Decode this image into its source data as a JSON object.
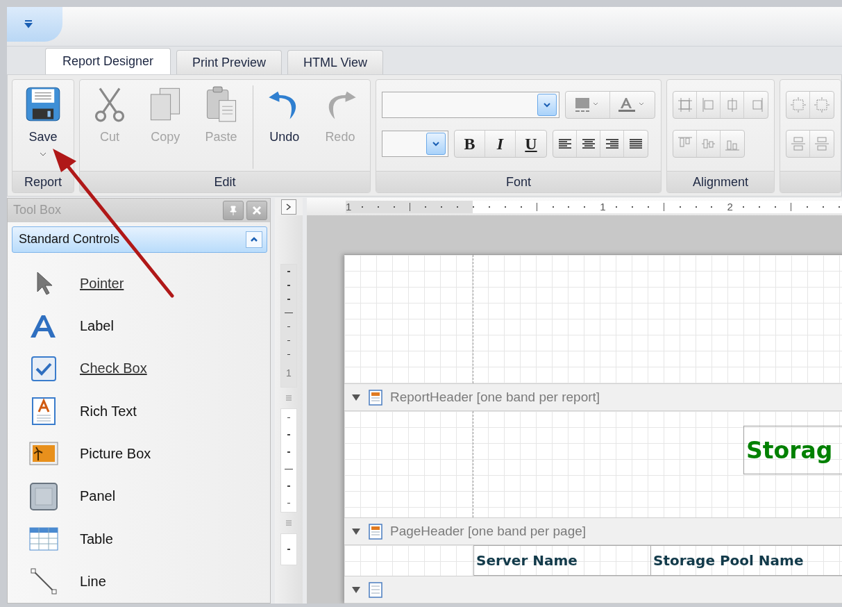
{
  "tabs": [
    {
      "label": "Report Designer",
      "selected": true
    },
    {
      "label": "Print Preview",
      "selected": false
    },
    {
      "label": "HTML View",
      "selected": false
    }
  ],
  "ribbon": {
    "report_group": {
      "label": "Report",
      "save_button": {
        "label": "Save",
        "disabled": false
      }
    },
    "edit_group": {
      "label": "Edit",
      "clipboard": [
        {
          "label": "Cut",
          "disabled": true
        },
        {
          "label": "Copy",
          "disabled": true
        },
        {
          "label": "Paste",
          "disabled": true
        }
      ],
      "history": [
        {
          "label": "Undo",
          "disabled": false
        },
        {
          "label": "Redo",
          "disabled": true
        }
      ]
    },
    "font_group": {
      "label": "Font",
      "style_buttons": [
        "B",
        "I",
        "U"
      ]
    },
    "alignment_group": {
      "label": "Alignment"
    }
  },
  "toolbox": {
    "title": "Tool Box",
    "section": {
      "title": "Standard Controls",
      "expanded": true,
      "items": [
        {
          "label": "Pointer",
          "underlined": true
        },
        {
          "label": "Label",
          "underlined": false
        },
        {
          "label": "Check Box",
          "underlined": true
        },
        {
          "label": "Rich Text",
          "underlined": false
        },
        {
          "label": "Picture Box",
          "underlined": false
        },
        {
          "label": "Panel",
          "underlined": false
        },
        {
          "label": "Table",
          "underlined": false
        },
        {
          "label": "Line",
          "underlined": false
        }
      ]
    }
  },
  "designer": {
    "ruler": {
      "h_labels": [
        "1",
        "1",
        "2"
      ],
      "v_labels": [
        "1"
      ]
    },
    "bands": [
      {
        "label": "ReportHeader [one band per report]",
        "expanded": true
      },
      {
        "label": "PageHeader [one band per page]",
        "expanded": true
      }
    ],
    "report_title": "Storag",
    "column_headers": [
      "Server Name",
      "Storage Pool Name"
    ]
  }
}
